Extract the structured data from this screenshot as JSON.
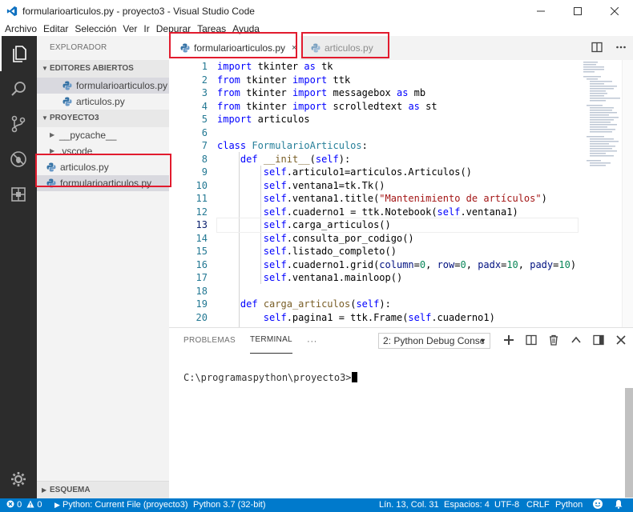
{
  "window": {
    "title": "formularioarticulos.py - proyecto3 - Visual Studio Code"
  },
  "menu": [
    "Archivo",
    "Editar",
    "Selección",
    "Ver",
    "Ir",
    "Depurar",
    "Tareas",
    "Ayuda"
  ],
  "sidebar": {
    "title": "EXPLORADOR",
    "open_editors": {
      "label": "EDITORES ABIERTOS",
      "files": [
        "formularioarticulos.py",
        "articulos.py"
      ]
    },
    "project": {
      "label": "PROYECTO3",
      "folders": [
        "__pycache__",
        ".vscode"
      ],
      "files": [
        "articulos.py",
        "formularioarticulos.py"
      ]
    },
    "outline_label": "ESQUEMA"
  },
  "tabs": [
    {
      "label": "formularioarticulos.py",
      "close": "×"
    },
    {
      "label": "articulos.py"
    }
  ],
  "editor": {
    "line_numbers": [
      "1",
      "2",
      "3",
      "4",
      "5",
      "6",
      "7",
      "8",
      "9",
      "10",
      "11",
      "12",
      "13",
      "14",
      "15",
      "16",
      "17",
      "18",
      "19",
      "20"
    ],
    "current_line": 13
  },
  "panel": {
    "tabs": [
      "PROBLEMAS",
      "TERMINAL",
      "···"
    ],
    "terminal_select": "2: Python Debug Consc",
    "prompt": "C:\\programaspython\\proyecto3>"
  },
  "status": {
    "errors": "0",
    "warnings": "0",
    "run_config": "Python: Current File (proyecto3)",
    "interpreter": "Python 3.7 (32-bit)",
    "position": "Lín. 13, Col. 31",
    "spaces": "Espacios: 4",
    "encoding": "UTF-8",
    "eol": "CRLF",
    "language": "Python"
  },
  "colors": {
    "activity_bar": "#2c2c2c",
    "status_bar": "#007acc",
    "annotation": "#e21b2e"
  }
}
